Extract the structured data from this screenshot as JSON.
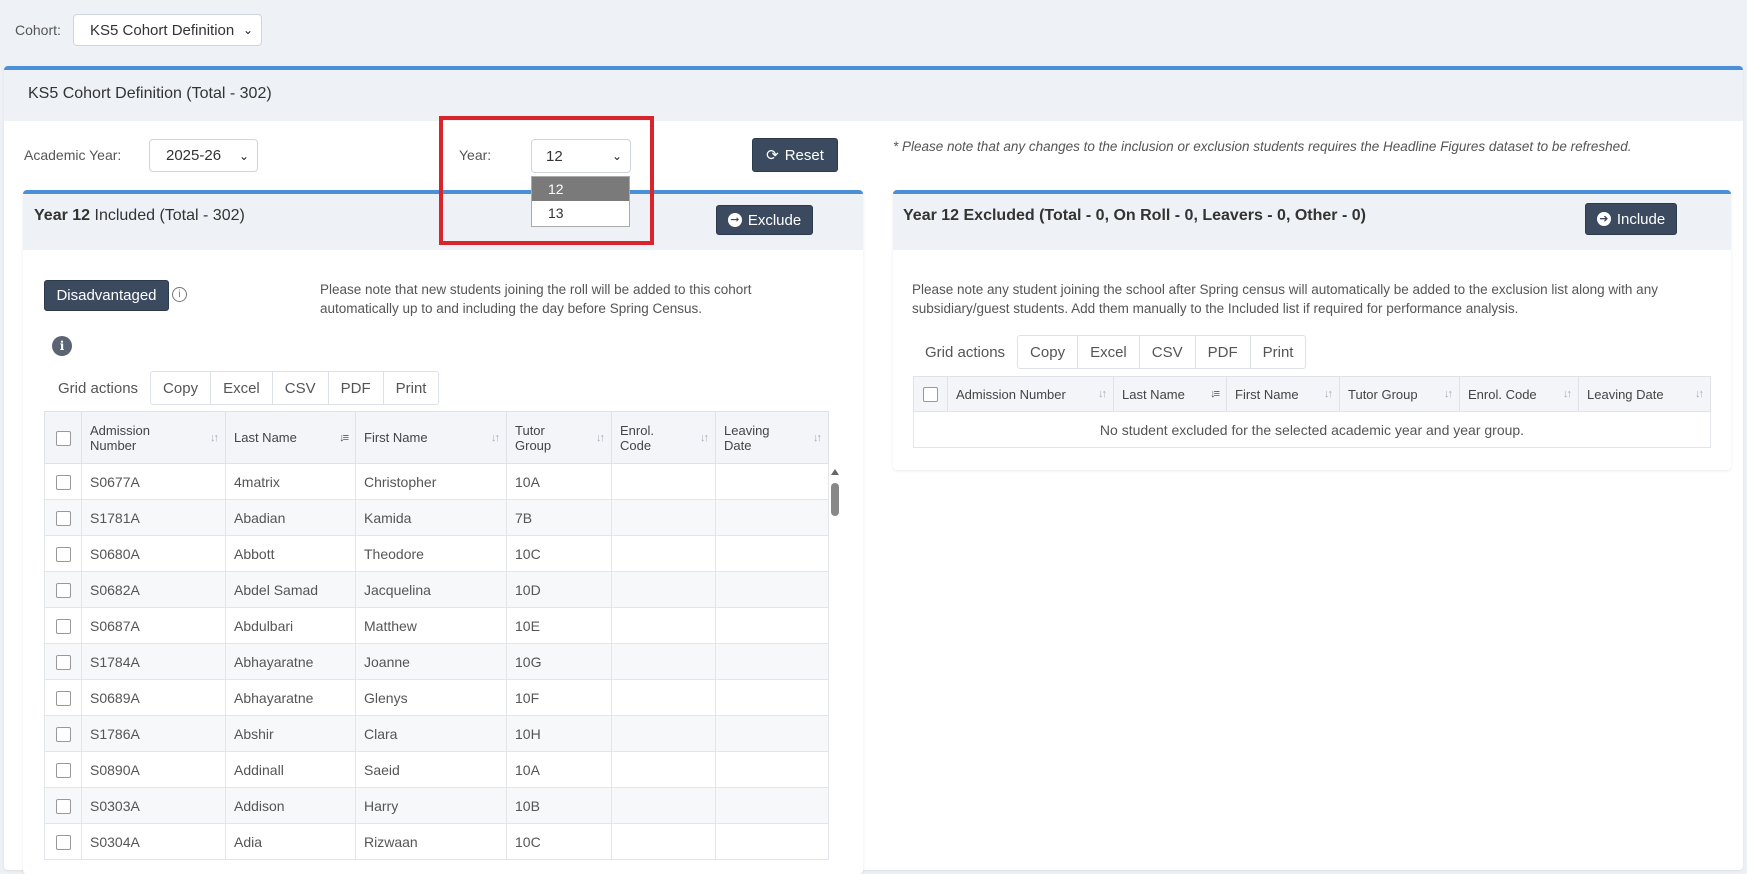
{
  "cohort": {
    "label": "Cohort:",
    "value": "KS5 Cohort Definition"
  },
  "card_title": "KS5 Cohort Definition (Total - 302)",
  "filters": {
    "academic_year_label": "Academic Year:",
    "academic_year_value": "2025-26",
    "year_label": "Year:",
    "year_value": "12",
    "year_options": [
      "12",
      "13"
    ],
    "reset_label": "Reset"
  },
  "refresh_note": "* Please note that any changes to the inclusion or exclusion students requires the Headline Figures dataset to be refreshed.",
  "included": {
    "title_year": "Year 12",
    "title_rest": " Included (Total - 302)",
    "exclude_label": "Exclude",
    "disadvantaged_label": "Disadvantaged",
    "note_line1": "Please note that new students joining the roll will be added to this cohort",
    "note_line2": "automatically up to and including the day before Spring Census.",
    "grid_actions": {
      "label": "Grid actions",
      "copy": "Copy",
      "excel": "Excel",
      "csv": "CSV",
      "pdf": "PDF",
      "print": "Print"
    },
    "columns": {
      "admission": [
        "Admission",
        "Number"
      ],
      "last": "Last Name",
      "first": "First Name",
      "tutor": [
        "Tutor",
        "Group"
      ],
      "enrol": [
        "Enrol.",
        "Code"
      ],
      "leaving": [
        "Leaving",
        "Date"
      ]
    },
    "rows": [
      [
        "S0677A",
        "4matrix",
        "Christopher",
        "10A"
      ],
      [
        "S1781A",
        "Abadian",
        "Kamida",
        "7B"
      ],
      [
        "S0680A",
        "Abbott",
        "Theodore",
        "10C"
      ],
      [
        "S0682A",
        "Abdel Samad",
        "Jacquelina",
        "10D"
      ],
      [
        "S0687A",
        "Abdulbari",
        "Matthew",
        "10E"
      ],
      [
        "S1784A",
        "Abhayaratne",
        "Joanne",
        "10G"
      ],
      [
        "S0689A",
        "Abhayaratne",
        "Glenys",
        "10F"
      ],
      [
        "S1786A",
        "Abshir",
        "Clara",
        "10H"
      ],
      [
        "S0890A",
        "Addinall",
        "Saeid",
        "10A"
      ],
      [
        "S0303A",
        "Addison",
        "Harry",
        "10B"
      ],
      [
        "S0304A",
        "Adia",
        "Rizwaan",
        "10C"
      ]
    ]
  },
  "excluded": {
    "title_year": "Year 12",
    "title_rest": " Excluded (Total - 0, On Roll - 0, Leavers - 0, Other - 0)",
    "include_label": "Include",
    "note_line1": "Please note any student joining the school after Spring census will automatically be added to the exclusion list along with any",
    "note_line2": "subsidiary/guest students. Add them manually to the Included list if required for performance analysis.",
    "grid_actions": {
      "label": "Grid actions",
      "copy": "Copy",
      "excel": "Excel",
      "csv": "CSV",
      "pdf": "PDF",
      "print": "Print"
    },
    "columns": {
      "admission": "Admission Number",
      "last": "Last Name",
      "first": "First Name",
      "tutor": "Tutor Group",
      "enrol": "Enrol. Code",
      "leaving": "Leaving Date"
    },
    "empty_message": "No student excluded for the selected academic year and year group."
  },
  "colors": {
    "accent": "#4a90d9",
    "dark_button": "#3b4a5f",
    "highlight_box": "#d9242b",
    "selected_option": "#7a7a7a"
  }
}
